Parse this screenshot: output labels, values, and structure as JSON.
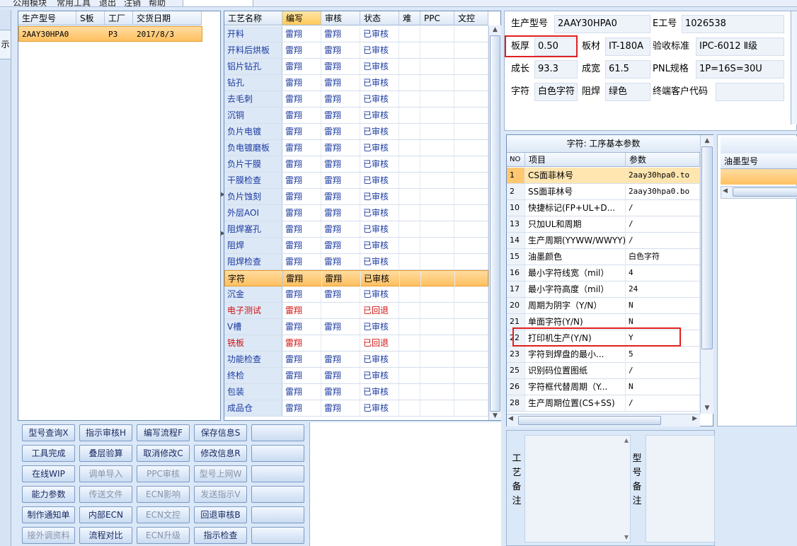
{
  "menu": {
    "items": [
      "公用模块",
      "常用工具",
      "退出",
      "注销",
      "帮助"
    ]
  },
  "left_strip": {
    "tab_label": "示"
  },
  "models_grid": {
    "columns": [
      "生产型号",
      "S板",
      "工厂",
      "交货日期"
    ],
    "rows": [
      {
        "model": "2AAY30HPA0",
        "s_board": "",
        "factory": "P3",
        "delivery": "2017/8/3"
      }
    ]
  },
  "process_grid": {
    "columns": [
      "工艺名称",
      "编写",
      "审核",
      "状态",
      "难",
      "PPC",
      "文控"
    ],
    "rows": [
      {
        "name": "开料",
        "writer": "雷翔",
        "reviewer": "雷翔",
        "status": "已审核",
        "tone": "blue"
      },
      {
        "name": "开料后烘板",
        "writer": "雷翔",
        "reviewer": "雷翔",
        "status": "已审核",
        "tone": "blue"
      },
      {
        "name": "铝片钻孔",
        "writer": "雷翔",
        "reviewer": "雷翔",
        "status": "已审核",
        "tone": "blue"
      },
      {
        "name": "钻孔",
        "writer": "雷翔",
        "reviewer": "雷翔",
        "status": "已审核",
        "tone": "blue"
      },
      {
        "name": "去毛刺",
        "writer": "雷翔",
        "reviewer": "雷翔",
        "status": "已审核",
        "tone": "blue"
      },
      {
        "name": "沉铜",
        "writer": "雷翔",
        "reviewer": "雷翔",
        "status": "已审核",
        "tone": "blue"
      },
      {
        "name": "负片电镀",
        "writer": "雷翔",
        "reviewer": "雷翔",
        "status": "已审核",
        "tone": "blue"
      },
      {
        "name": "负电镀磨板",
        "writer": "雷翔",
        "reviewer": "雷翔",
        "status": "已审核",
        "tone": "blue"
      },
      {
        "name": "负片干膜",
        "writer": "雷翔",
        "reviewer": "雷翔",
        "status": "已审核",
        "tone": "blue"
      },
      {
        "name": "干膜检查",
        "writer": "雷翔",
        "reviewer": "雷翔",
        "status": "已审核",
        "tone": "blue"
      },
      {
        "name": "负片蚀刻",
        "writer": "雷翔",
        "reviewer": "雷翔",
        "status": "已审核",
        "tone": "blue"
      },
      {
        "name": "外层AOI",
        "writer": "雷翔",
        "reviewer": "雷翔",
        "status": "已审核",
        "tone": "blue"
      },
      {
        "name": "阻焊塞孔",
        "writer": "雷翔",
        "reviewer": "雷翔",
        "status": "已审核",
        "tone": "blue"
      },
      {
        "name": "阻焊",
        "writer": "雷翔",
        "reviewer": "雷翔",
        "status": "已审核",
        "tone": "blue"
      },
      {
        "name": "阻焊检查",
        "writer": "雷翔",
        "reviewer": "雷翔",
        "status": "已审核",
        "tone": "blue"
      },
      {
        "name": "字符",
        "writer": "雷翔",
        "reviewer": "雷翔",
        "status": "已审核",
        "tone": "sel"
      },
      {
        "name": "沉金",
        "writer": "雷翔",
        "reviewer": "雷翔",
        "status": "已审核",
        "tone": "blue"
      },
      {
        "name": "电子测试",
        "writer": "雷翔",
        "reviewer": "",
        "status": "已回退",
        "tone": "red"
      },
      {
        "name": "V槽",
        "writer": "雷翔",
        "reviewer": "雷翔",
        "status": "已审核",
        "tone": "blue"
      },
      {
        "name": "铣板",
        "writer": "雷翔",
        "reviewer": "",
        "status": "已回退",
        "tone": "red"
      },
      {
        "name": "功能检查",
        "writer": "雷翔",
        "reviewer": "雷翔",
        "status": "已审核",
        "tone": "blue"
      },
      {
        "name": "终检",
        "writer": "雷翔",
        "reviewer": "雷翔",
        "status": "已审核",
        "tone": "blue"
      },
      {
        "name": "包装",
        "writer": "雷翔",
        "reviewer": "雷翔",
        "status": "已审核",
        "tone": "blue"
      },
      {
        "name": "成品仓",
        "writer": "雷翔",
        "reviewer": "雷翔",
        "status": "已审核",
        "tone": "blue"
      }
    ]
  },
  "actions": {
    "rows": [
      [
        {
          "label": "型号查询X",
          "enabled": true
        },
        {
          "label": "指示审核H",
          "enabled": true
        },
        {
          "label": "编写流程F",
          "enabled": true
        },
        {
          "label": "保存信息S",
          "enabled": true
        },
        {
          "label": "",
          "enabled": true
        }
      ],
      [
        {
          "label": "工具完成",
          "enabled": true
        },
        {
          "label": "叠层验算",
          "enabled": true
        },
        {
          "label": "取消修改C",
          "enabled": true
        },
        {
          "label": "修改信息R",
          "enabled": true
        },
        {
          "label": "",
          "enabled": true
        }
      ],
      [
        {
          "label": "在线WIP",
          "enabled": true
        },
        {
          "label": "调单导入",
          "enabled": false
        },
        {
          "label": "PPC审核",
          "enabled": false
        },
        {
          "label": "型号上网W",
          "enabled": false
        },
        {
          "label": "",
          "enabled": true
        }
      ],
      [
        {
          "label": "能力参数",
          "enabled": true
        },
        {
          "label": "传送文件",
          "enabled": false
        },
        {
          "label": "ECN影响",
          "enabled": false
        },
        {
          "label": "发送指示V",
          "enabled": false
        },
        {
          "label": "",
          "enabled": true
        }
      ],
      [
        {
          "label": "制作通知单",
          "enabled": true
        },
        {
          "label": "内部ECN",
          "enabled": true
        },
        {
          "label": "ECN文控",
          "enabled": false
        },
        {
          "label": "回退审核B",
          "enabled": true
        },
        {
          "label": "",
          "enabled": true
        }
      ],
      [
        {
          "label": "接外调资料",
          "enabled": false
        },
        {
          "label": "流程对比",
          "enabled": true
        },
        {
          "label": "ECN升级",
          "enabled": false
        },
        {
          "label": "指示检查",
          "enabled": true
        },
        {
          "label": "",
          "enabled": true
        }
      ]
    ]
  },
  "info": {
    "model_label": "生产型号",
    "model_value": "2AAY30HPA0",
    "eng_label": "E工号",
    "eng_value": "1026538",
    "thickness_label": "板厚",
    "thickness_value": "0.50",
    "material_label": "板材",
    "material_value": "IT-180A",
    "standard_label": "验收标准",
    "standard_value": "IPC-6012 Ⅱ级",
    "length_label": "成长",
    "length_value": "93.3",
    "width_label": "成宽",
    "width_value": "61.5",
    "pnl_label": "PNL规格",
    "pnl_value": "1P=16S=30U",
    "char_label": "字符",
    "char_value": "白色字符",
    "mask_label": "阻焊",
    "mask_value": "绿色",
    "customer_label": "终端客户代码",
    "customer_value": ""
  },
  "params": {
    "title": "字符: 工序基本参数",
    "columns": [
      "NO",
      "项目",
      "参数"
    ],
    "rows": [
      {
        "no": "1",
        "item": "CS面菲林号",
        "value": "2aay30hpa0.to",
        "highlight": true
      },
      {
        "no": "2",
        "item": "SS面菲林号",
        "value": "2aay30hpa0.bo"
      },
      {
        "no": "10",
        "item": "快捷标记(FP+UL+D...",
        "value": "/"
      },
      {
        "no": "13",
        "item": "只加UL和周期",
        "value": "/"
      },
      {
        "no": "14",
        "item": "生产周期(YYWW/WWYY)",
        "value": "/"
      },
      {
        "no": "15",
        "item": "油墨颜色",
        "value": "白色字符"
      },
      {
        "no": "16",
        "item": "最小字符线宽（mil）",
        "value": "4"
      },
      {
        "no": "17",
        "item": "最小字符高度（mil）",
        "value": "24"
      },
      {
        "no": "20",
        "item": "周期为阴字（Y/N）",
        "value": "N"
      },
      {
        "no": "21",
        "item": "单面字符(Y/N)",
        "value": "N"
      },
      {
        "no": "22",
        "item": "打印机生产(Y/N)",
        "value": "Y"
      },
      {
        "no": "23",
        "item": "字符到焊盘的最小...",
        "value": "5"
      },
      {
        "no": "25",
        "item": "识别码位置图纸",
        "value": "/"
      },
      {
        "no": "26",
        "item": "字符框代替周期（Y...",
        "value": "N"
      },
      {
        "no": "28",
        "item": "生产周期位置(CS+SS)",
        "value": "/"
      }
    ]
  },
  "ink": {
    "header": "油墨型号"
  },
  "notes": {
    "process_label": "工艺备注",
    "model_label": "型号备注"
  }
}
